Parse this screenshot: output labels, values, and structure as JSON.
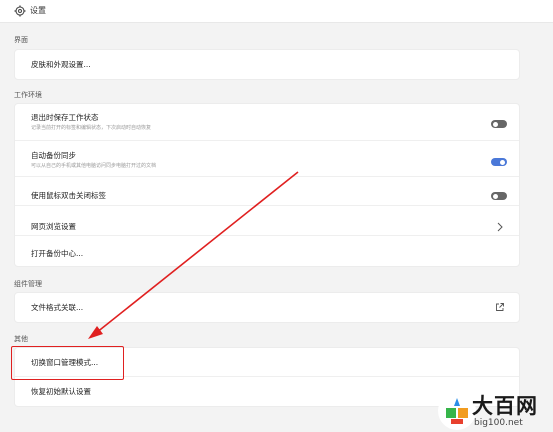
{
  "header": {
    "title": "设置",
    "icon": "gear-icon"
  },
  "sections": {
    "interface": {
      "label": "界面",
      "items": [
        {
          "label": "皮肤和外观设置..."
        }
      ]
    },
    "workspace": {
      "label": "工作环境",
      "items": [
        {
          "label": "退出时保存工作状态",
          "desc": "记录当前打开的标签和编辑状态，下次启动时自动恢复",
          "control": "toggle",
          "on": false
        },
        {
          "label": "自动备份同步",
          "desc": "可以从自己的手机或其他电脑访问同步电脑打开过的文档",
          "control": "toggle",
          "on": true
        },
        {
          "label": "使用鼠标双击关闭标签",
          "control": "toggle",
          "on": false
        },
        {
          "label": "网页浏览设置",
          "control": "chevron-right-icon"
        },
        {
          "label": "打开备份中心..."
        }
      ]
    },
    "components": {
      "label": "组件管理",
      "items": [
        {
          "label": "文件格式关联...",
          "control": "external-link-icon"
        }
      ]
    },
    "other": {
      "label": "其他",
      "items": [
        {
          "label": "切换窗口管理模式..."
        },
        {
          "label": "恢复初始默认设置"
        }
      ]
    }
  },
  "annotation": {
    "highlight_color": "#e02020",
    "arrow_color": "#e02020"
  },
  "watermark": {
    "brand": "大百网",
    "sub": "big100.net"
  },
  "colors": {
    "toggle_on": "#4a78d8",
    "toggle_off": "#666666",
    "background": "#f3f3f3"
  }
}
